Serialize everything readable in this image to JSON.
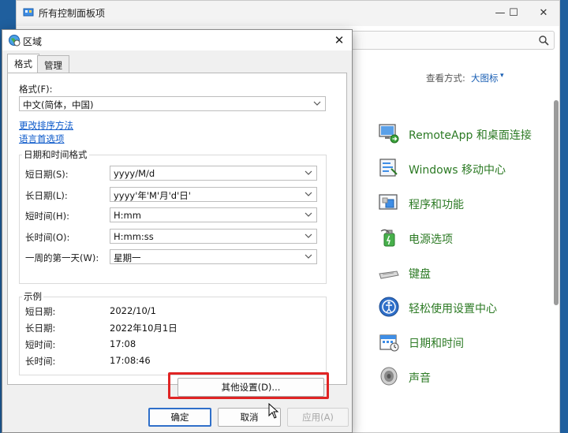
{
  "background_window": {
    "title": "所有控制面板项",
    "controls": {
      "minimize": "—",
      "maximize": "☐",
      "close": "✕"
    },
    "view_label": "查看方式:",
    "view_value": "大图标",
    "items": [
      {
        "label": "RemoteApp 和桌面连接",
        "icon": "remoteapp-icon"
      },
      {
        "label": "Windows 移动中心",
        "icon": "mobility-center-icon"
      },
      {
        "label": "程序和功能",
        "icon": "programs-icon"
      },
      {
        "label": "电源选项",
        "icon": "power-icon"
      },
      {
        "label": "键盘",
        "icon": "keyboard-icon"
      },
      {
        "label": "轻松使用设置中心",
        "icon": "ease-of-access-icon"
      },
      {
        "label": "日期和时间",
        "icon": "date-time-icon"
      },
      {
        "label": "声音",
        "icon": "sound-icon"
      }
    ]
  },
  "dialog": {
    "title": "区域",
    "close": "✕",
    "tabs": [
      {
        "label": "格式"
      },
      {
        "label": "管理"
      }
    ],
    "format_label": "格式(F):",
    "format_value": "中文(简体，中国)",
    "link_sort": "更改排序方法",
    "link_language": "语言首选项",
    "datetime_group": "日期和时间格式",
    "fields": [
      {
        "label": "短日期(S):",
        "value": "yyyy/M/d"
      },
      {
        "label": "长日期(L):",
        "value": "yyyy'年'M'月'd'日'"
      },
      {
        "label": "短时间(H):",
        "value": "H:mm"
      },
      {
        "label": "长时间(O):",
        "value": "H:mm:ss"
      },
      {
        "label": "一周的第一天(W):",
        "value": "星期一"
      }
    ],
    "example_group": "示例",
    "examples": [
      {
        "label": "短日期:",
        "value": "2022/10/1"
      },
      {
        "label": "长日期:",
        "value": "2022年10月1日"
      },
      {
        "label": "短时间:",
        "value": "17:08"
      },
      {
        "label": "长时间:",
        "value": "17:08:46"
      }
    ],
    "other_settings": "其他设置(D)...",
    "ok": "确定",
    "cancel": "取消",
    "apply": "应用(A)"
  },
  "colors": {
    "accent": "#2f6fc9",
    "link": "#0a58ca",
    "item_text": "#2c7a24",
    "highlight": "#e02424"
  }
}
